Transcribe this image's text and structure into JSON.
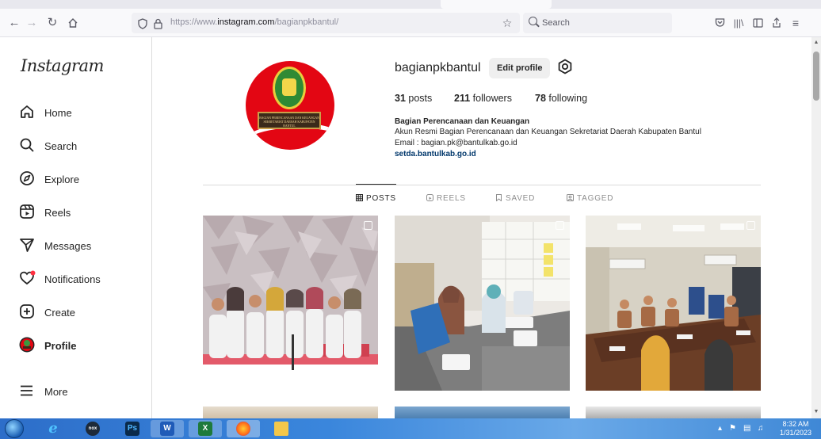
{
  "browser": {
    "url_prefix": "https://www.",
    "url_domain": "instagram.com",
    "url_path": "/bagianpkbantul/",
    "search_placeholder": "Search"
  },
  "sidebar": {
    "logo": "Instagram",
    "items": [
      {
        "label": "Home",
        "icon": "home-icon"
      },
      {
        "label": "Search",
        "icon": "search-icon"
      },
      {
        "label": "Explore",
        "icon": "compass-icon"
      },
      {
        "label": "Reels",
        "icon": "reels-icon"
      },
      {
        "label": "Messages",
        "icon": "send-icon"
      },
      {
        "label": "Notifications",
        "icon": "heart-icon"
      },
      {
        "label": "Create",
        "icon": "plus-square-icon"
      },
      {
        "label": "Profile",
        "icon": "profile-avatar-icon"
      },
      {
        "label": "More",
        "icon": "menu-icon"
      }
    ]
  },
  "profile": {
    "username": "bagianpkbantul",
    "edit_button": "Edit profile",
    "posts_count": "31",
    "posts_label": " posts",
    "followers_count": "211",
    "followers_label": " followers",
    "following_count": "78",
    "following_label": " following",
    "full_name": "Bagian Perencanaan dan Keuangan",
    "bio_line1": "Akun Resmi Bagian Perencanaan dan Keuangan Sekretariat Daerah Kabupaten Bantul",
    "bio_line2": "Email : bagian.pk@bantulkab.go.id",
    "bio_link": "setda.bantulkab.go.id",
    "avatar_badge": "BAGIAN PERENCANAAN DAN KEUANGAN SEKRETARIAT DAERAH KABUPATEN BANTUL"
  },
  "tabs": [
    {
      "label": "POSTS",
      "active": true
    },
    {
      "label": "REELS",
      "active": false
    },
    {
      "label": "SAVED",
      "active": false
    },
    {
      "label": "TAGGED",
      "active": false
    }
  ],
  "taskbar": {
    "time": "8:32 AM",
    "date": "1/31/2023"
  },
  "colors": {
    "ig_text": "#262626",
    "link": "#00376b",
    "notification_dot": "#ff3040"
  }
}
